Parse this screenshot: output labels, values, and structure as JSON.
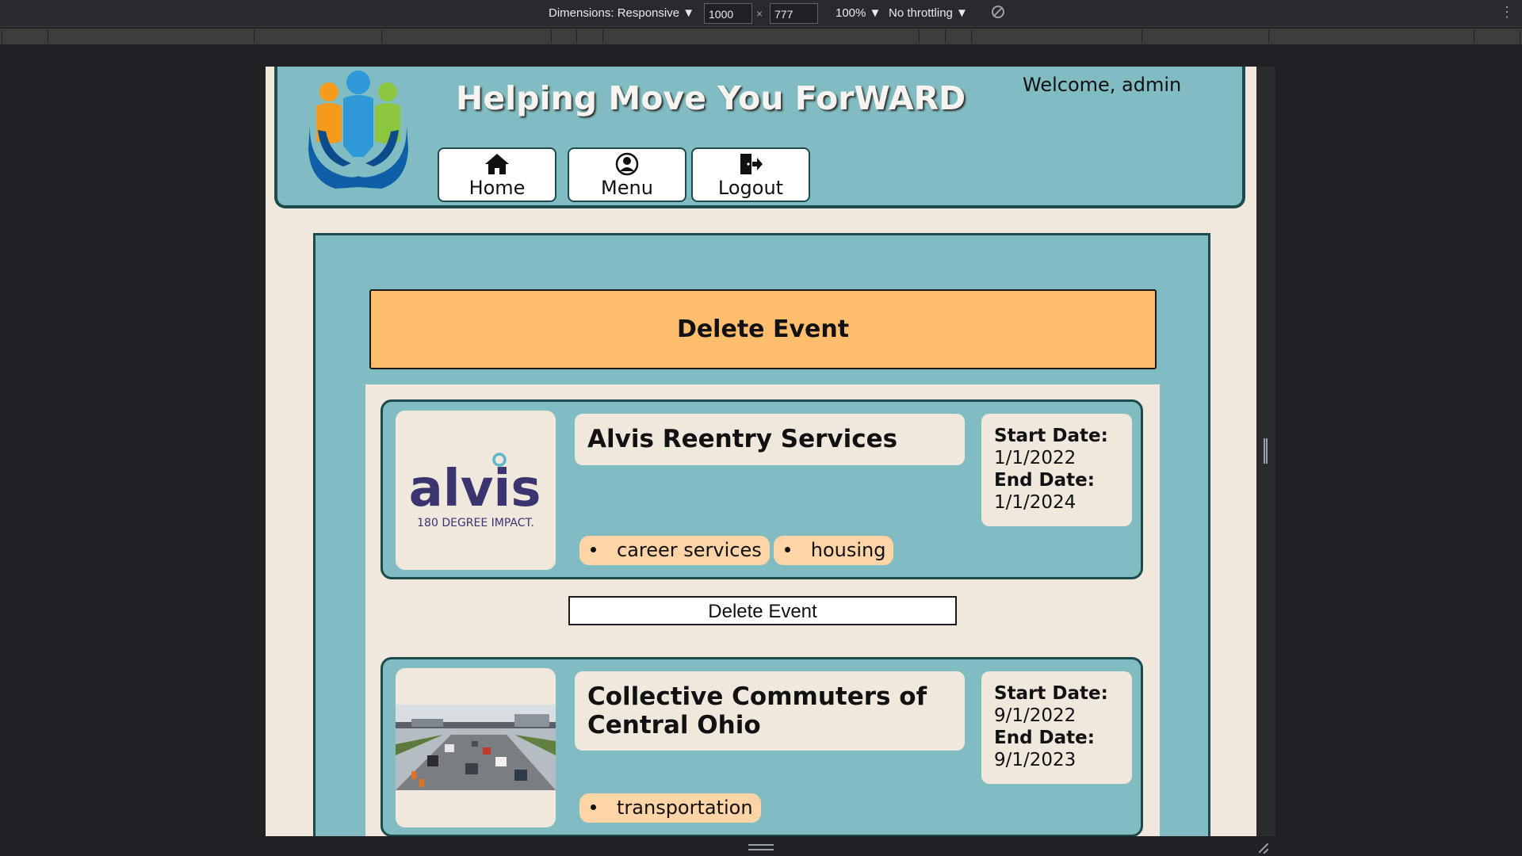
{
  "devtools": {
    "dimensions_label": "Dimensions: Responsive ▼",
    "width_value": "1000",
    "height_value": "777",
    "times_sign": "×",
    "zoom_label": "100% ▼",
    "throttling_label": "No throttling ▼",
    "more_glyph": "⋮"
  },
  "header": {
    "title": "Helping Move You ForWARD",
    "welcome": "Welcome, admin",
    "nav": [
      {
        "label": "Home",
        "icon": "home-icon"
      },
      {
        "label": "Menu",
        "icon": "user-circle-icon"
      },
      {
        "label": "Logout",
        "icon": "logout-icon"
      }
    ]
  },
  "main": {
    "heading": "Delete Event",
    "events": [
      {
        "title": "Alvis Reentry Services",
        "logo": {
          "wordmark": "alvis",
          "tagline": "180 DEGREE IMPACT."
        },
        "start_label": "Start Date:",
        "start_date": "1/1/2022",
        "end_label": "End Date:",
        "end_date": "1/1/2024",
        "tags": [
          "career services",
          "housing"
        ],
        "delete_label": "Delete Event"
      },
      {
        "title": "Collective Commuters of Central Ohio",
        "image": "highway-traffic-photo",
        "start_label": "Start Date:",
        "start_date": "9/1/2022",
        "end_label": "End Date:",
        "end_date": "9/1/2023",
        "tags": [
          "transportation"
        ]
      }
    ]
  },
  "colors": {
    "teal": "#80bcc1",
    "dark_teal": "#1c4b4e",
    "cream": "#f0e7dd",
    "orange": "#ffbd6e",
    "tag_peach": "#ffd4a6",
    "alvis_navy": "#3a3470",
    "alvis_dot": "#5bb9c9"
  }
}
